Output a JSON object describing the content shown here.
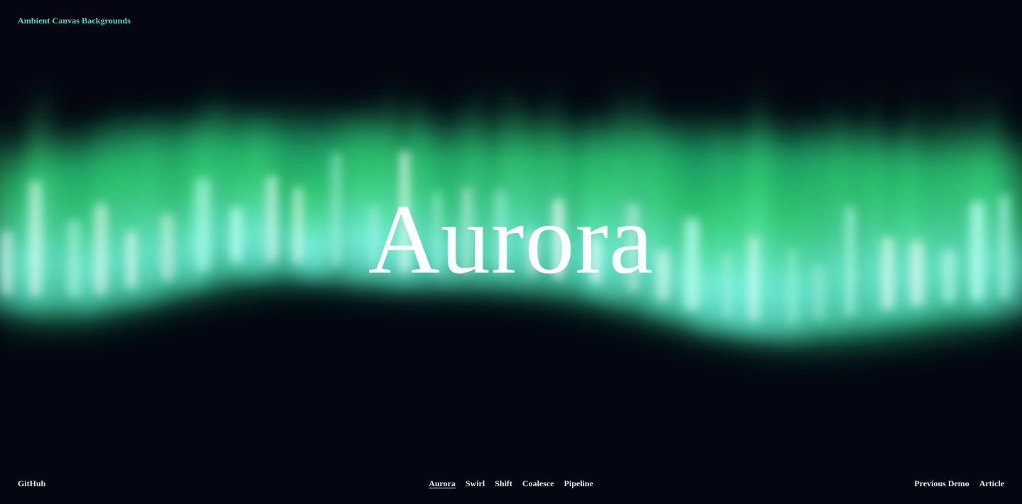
{
  "header": {
    "site_title": "Ambient Canvas Backgrounds"
  },
  "hero": {
    "title": "Aurora"
  },
  "footer": {
    "github_label": "GitHub",
    "demo_links": [
      "Aurora",
      "Swirl",
      "Shift",
      "Coalesce",
      "Pipeline"
    ],
    "active_demo": "Aurora",
    "previous_demo_label": "Previous Demo",
    "article_label": "Article"
  },
  "colors": {
    "background": "#040711",
    "aurora_green": "#3ee67a",
    "aurora_cyan": "#6ff5e6",
    "aurora_core": "#f2fffb",
    "site_title": "#5fd6c0",
    "text": "#ffffff"
  }
}
